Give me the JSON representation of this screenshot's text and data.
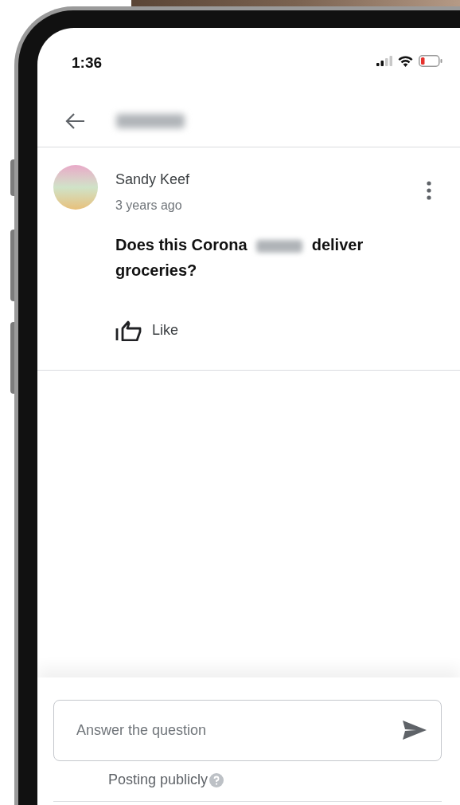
{
  "status_bar": {
    "time": "1:36"
  },
  "question": {
    "author": "Sandy Keef",
    "time": "3 years ago",
    "text_before": "Does this Corona",
    "text_after": "deliver groceries?",
    "like_label": "Like"
  },
  "answer_field": {
    "placeholder": "Answer the question"
  },
  "posting_note": "Posting publicly"
}
